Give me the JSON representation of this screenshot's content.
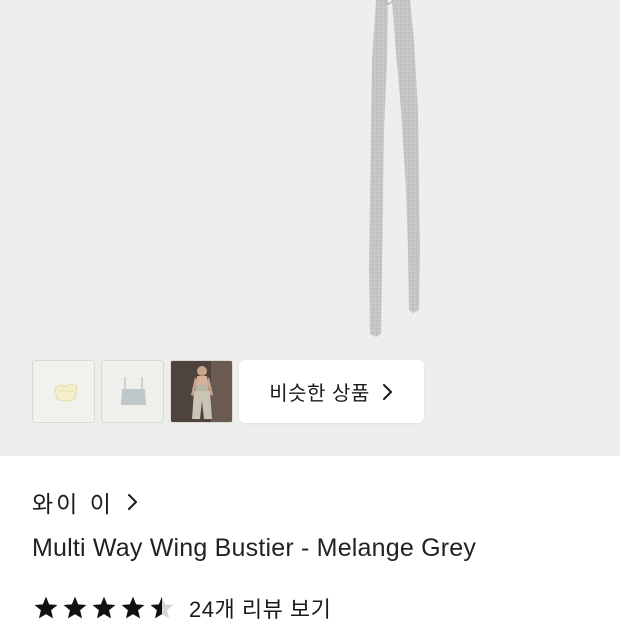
{
  "similar_button": {
    "label": "비슷한 상품"
  },
  "thumbnails": [
    {
      "name": "yellow-top"
    },
    {
      "name": "grey-top"
    },
    {
      "name": "model-photo"
    }
  ],
  "brand": {
    "name": "와이 이"
  },
  "product": {
    "title": "Multi Way Wing Bustier - Melange Grey"
  },
  "rating": {
    "value": 4.5,
    "max": 5,
    "review_link": "24개 리뷰 보기"
  },
  "colors": {
    "hero_bg": "#eeeeec",
    "strap": "#c4c4c2",
    "star": "#111111"
  }
}
